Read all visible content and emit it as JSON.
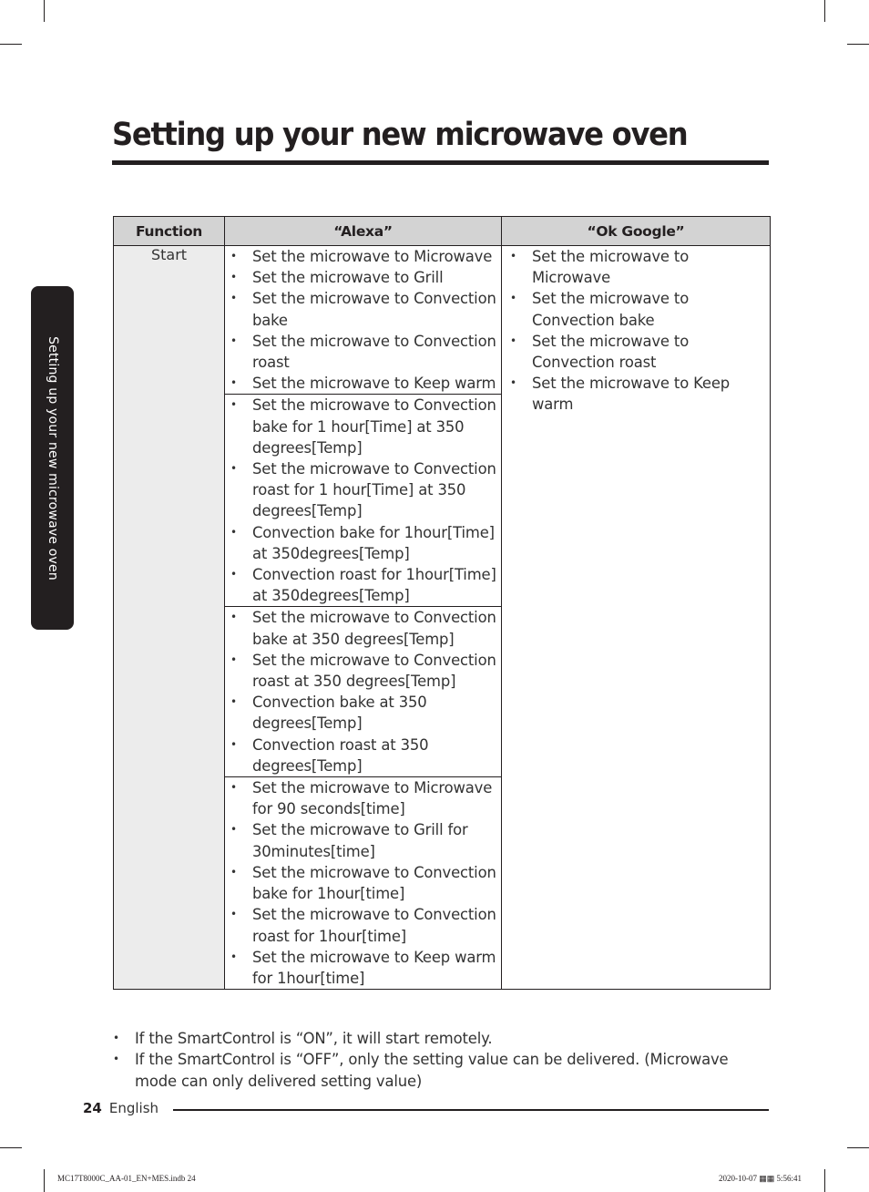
{
  "page": {
    "title": "Setting up your new microwave oven",
    "side_tab": "Setting up your new microwave oven",
    "page_number": "24",
    "language": "English",
    "slug_left": "MC17T8000C_AA-01_EN+MES.indb   24",
    "slug_right": "2020-10-07   ▦▦ 5:56:41"
  },
  "table": {
    "headers": [
      "Function",
      "“Alexa”",
      "“Ok Google”"
    ],
    "function": "Start",
    "alexa_groups": [
      [
        "Set the microwave to Microwave",
        "Set the microwave to Grill",
        "Set the microwave to Convection bake",
        "Set the microwave to Convection roast",
        "Set the microwave to Keep warm"
      ],
      [
        "Set the microwave to Convection bake for 1 hour[Time] at 350 degrees[Temp]",
        "Set the microwave to Convection roast for 1 hour[Time] at 350 degrees[Temp]",
        "Convection bake for 1hour[Time] at 350degrees[Temp]",
        "Convection roast for 1hour[Time] at 350degrees[Temp]"
      ],
      [
        "Set the microwave to Convection bake at 350 degrees[Temp]",
        "Set the microwave to Convection roast at 350 degrees[Temp]",
        "Convection bake at 350 degrees[Temp]",
        "Convection roast at 350 degrees[Temp]"
      ],
      [
        "Set the microwave to Microwave for 90 seconds[time]",
        "Set the microwave to Grill for 30minutes[time]",
        "Set the microwave to Convection bake for 1hour[time]",
        "Set the microwave to Convection roast for 1hour[time]",
        "Set the microwave to Keep warm for 1hour[time]"
      ]
    ],
    "google": [
      "Set the microwave to Microwave",
      "Set the microwave to Convection bake",
      "Set the microwave to Convection roast",
      "Set the microwave to Keep warm"
    ]
  },
  "notes": [
    "If the SmartControl is “ON”, it will start remotely.",
    "If the SmartControl is “OFF”, only the setting value can be delivered. (Microwave mode can only delivered setting value)"
  ],
  "bullet": "•"
}
